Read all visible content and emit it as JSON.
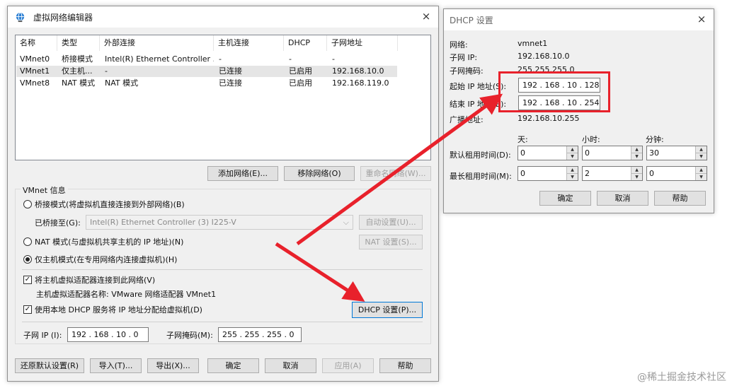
{
  "left_window": {
    "title": "虚拟网络编辑器",
    "close": "×",
    "columns": [
      "名称",
      "类型",
      "外部连接",
      "主机连接",
      "DHCP",
      "子网地址"
    ],
    "rows": [
      {
        "name": "VMnet0",
        "type": "桥接模式",
        "external": "Intel(R) Ethernet Controller ...",
        "host": "-",
        "dhcp": "-",
        "subnet": "-"
      },
      {
        "name": "VMnet1",
        "type": "仅主机...",
        "external": "-",
        "host": "已连接",
        "dhcp": "已启用",
        "subnet": "192.168.10.0"
      },
      {
        "name": "VMnet8",
        "type": "NAT 模式",
        "external": "NAT 模式",
        "host": "已连接",
        "dhcp": "已启用",
        "subnet": "192.168.119.0"
      }
    ],
    "add_network": "添加网络(E)...",
    "remove_network": "移除网络(O)",
    "rename_network": "重命名网络(W)...",
    "vmnet_info": "VMnet 信息",
    "bridged_radio": "桥接模式(将虚拟机直接连接到外部网络)(B)",
    "bridged_to_label": "已桥接至(G):",
    "bridged_to_value": "Intel(R) Ethernet Controller (3) I225-V",
    "auto_settings": "自动设置(U)...",
    "nat_radio": "NAT 模式(与虚拟机共享主机的 IP 地址)(N)",
    "nat_settings": "NAT 设置(S)...",
    "hostonly_radio": "仅主机模式(在专用网络内连接虚拟机)(H)",
    "connect_adapter": "将主机虚拟适配器连接到此网络(V)",
    "adapter_name": "主机虚拟适配器名称: VMware 网络适配器 VMnet1",
    "use_dhcp": "使用本地 DHCP 服务将 IP 地址分配给虚拟机(D)",
    "dhcp_settings": "DHCP 设置(P)...",
    "subnet_ip_label": "子网 IP (I):",
    "subnet_ip_value": "192 . 168 .  10  .  0",
    "subnet_mask_label": "子网掩码(M):",
    "subnet_mask_value": "255 . 255 . 255 .  0",
    "restore_defaults": "还原默认设置(R)",
    "import": "导入(T)...",
    "export": "导出(X)...",
    "ok": "确定",
    "cancel": "取消",
    "apply": "应用(A)",
    "help": "帮助"
  },
  "dhcp_window": {
    "title": "DHCP 设置",
    "close": "×",
    "network_label": "网络:",
    "network_value": "vmnet1",
    "subnet_ip_label": "子网 IP:",
    "subnet_ip_value": "192.168.10.0",
    "subnet_mask_label": "子网掩码:",
    "subnet_mask_value": "255.255.255.0",
    "start_ip_label": "起始 IP 地址(S):",
    "start_ip_value": "192 . 168 .  10  . 128",
    "end_ip_label": "结束 IP 地址(E):",
    "end_ip_value": "192 . 168 .  10  . 254",
    "broadcast_label": "广播地址:",
    "broadcast_value": "192.168.10.255",
    "days_header": "天:",
    "hours_header": "小时:",
    "minutes_header": "分钟:",
    "default_lease_label": "默认租用时间(D):",
    "default_lease_days": "0",
    "default_lease_hours": "0",
    "default_lease_minutes": "30",
    "max_lease_label": "最长租用时间(M):",
    "max_lease_days": "0",
    "max_lease_hours": "2",
    "max_lease_minutes": "0",
    "ok": "确定",
    "cancel": "取消",
    "help": "帮助"
  },
  "watermark": "@稀土掘金技术社区",
  "colors": {
    "annotation_red": "#e8212b",
    "selection_gray": "#e5e5e5"
  }
}
